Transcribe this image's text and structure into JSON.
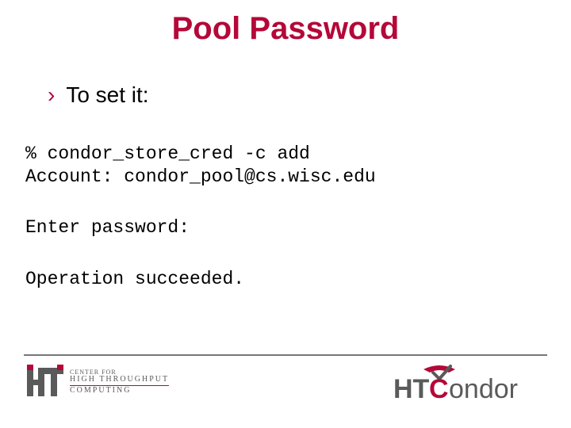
{
  "title": "Pool Password",
  "bullet": {
    "marker": "›",
    "text": "To set it:"
  },
  "code": {
    "block1_line1": "% condor_store_cred -c add",
    "block1_line2": "Account: condor_pool@cs.wisc.edu",
    "block2": "Enter password:",
    "block3": "Operation succeeded."
  },
  "footer": {
    "left_logo": {
      "line1": "CENTER FOR",
      "line2": "HIGH THROUGHPUT",
      "line3": "COMPUTING"
    },
    "right_logo": {
      "text": "HTCondor"
    }
  },
  "colors": {
    "accent": "#b40838",
    "text": "#000000",
    "rule": "#777777",
    "gray": "#5a5a5a"
  }
}
